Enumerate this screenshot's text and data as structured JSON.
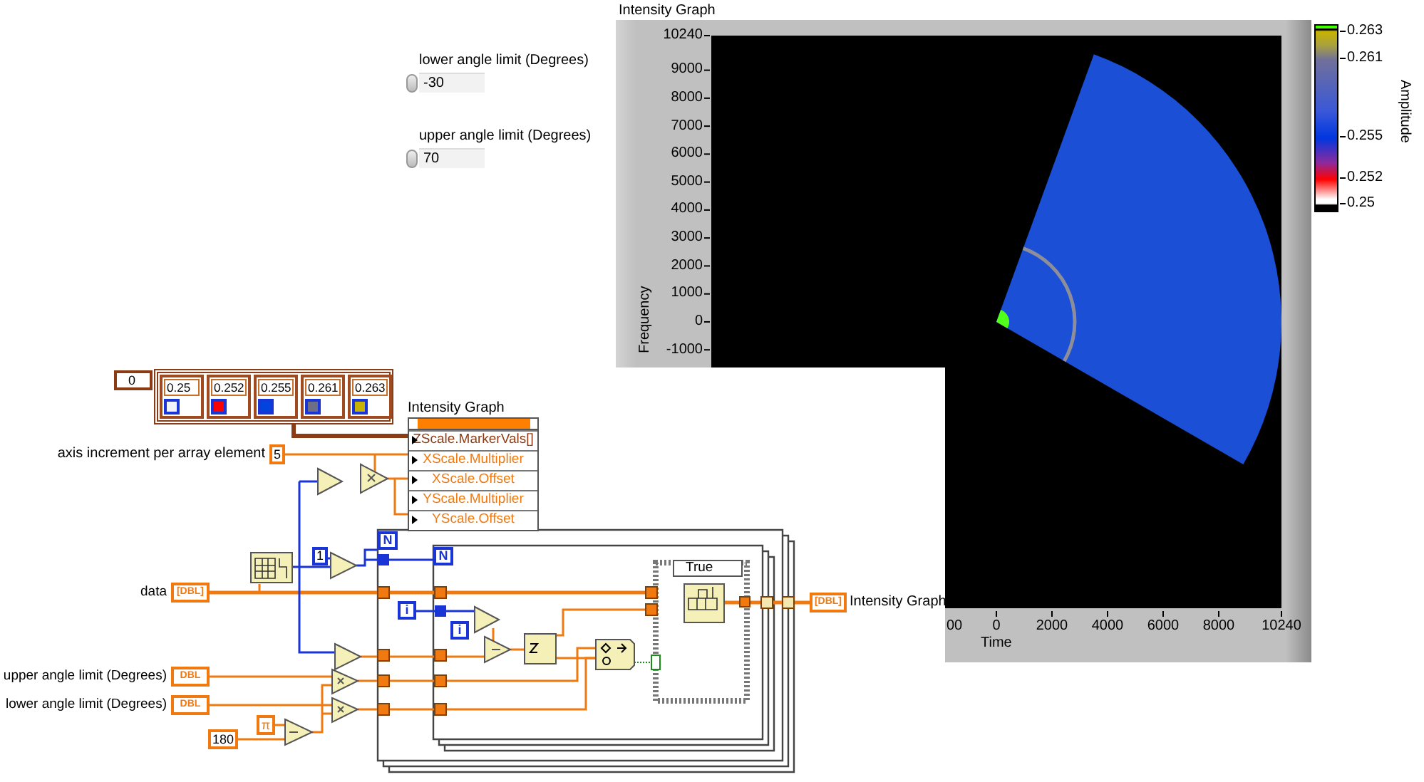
{
  "front_panel": {
    "controls": [
      {
        "label": "lower angle limit (Degrees)",
        "value": "-30"
      },
      {
        "label": "upper angle limit (Degrees)",
        "value": "70"
      }
    ],
    "intensity_graph": {
      "label": "Intensity Graph",
      "y_title": "Frequency",
      "y_ticks": [
        "10240",
        "9000",
        "8000",
        "7000",
        "6000",
        "5000",
        "4000",
        "3000",
        "2000",
        "1000",
        "0",
        "-1000"
      ],
      "x_title": "Time",
      "x_ticks": [
        "00",
        "0",
        "2000",
        "4000",
        "6000",
        "8000",
        "10240"
      ],
      "scale_title": "Amplitude",
      "scale_ticks": [
        "0.263",
        "0.261",
        "0.255",
        "0.252",
        "0.25"
      ]
    }
  },
  "block_diagram": {
    "array_index": "0",
    "marker_array": [
      {
        "value": "0.25",
        "color": "#f2f2fa"
      },
      {
        "value": "0.252",
        "color": "#ff0000"
      },
      {
        "value": "0.255",
        "color": "#0044dd"
      },
      {
        "value": "0.261",
        "color": "#6e6e86"
      },
      {
        "value": "0.263",
        "color": "#c8b400"
      }
    ],
    "property_node": {
      "label": "Intensity Graph",
      "properties": [
        {
          "name": "ZScale.MarkerVals[]",
          "kind": "cluster_array"
        },
        {
          "name": "XScale.Multiplier",
          "kind": "numeric"
        },
        {
          "name": "XScale.Offset",
          "kind": "numeric"
        },
        {
          "name": "YScale.Multiplier",
          "kind": "numeric"
        },
        {
          "name": "YScale.Offset",
          "kind": "numeric"
        }
      ]
    },
    "axis_increment": {
      "label": "axis increment per array element",
      "value": "5"
    },
    "inputs": [
      {
        "label": "data",
        "type": "[DBL]"
      },
      {
        "label": "upper angle limit (Degrees)",
        "type": "DBL"
      },
      {
        "label": "lower angle limit (Degrees)",
        "type": "DBL"
      }
    ],
    "constants": {
      "degrees": "180",
      "pi": "π",
      "one": "1"
    },
    "loop_count_labels": [
      "N",
      "N"
    ],
    "iteration_labels": [
      "i",
      "i"
    ],
    "case_selector": "True",
    "output": {
      "label": "Intensity Graph",
      "type": "[DBL]"
    }
  }
}
